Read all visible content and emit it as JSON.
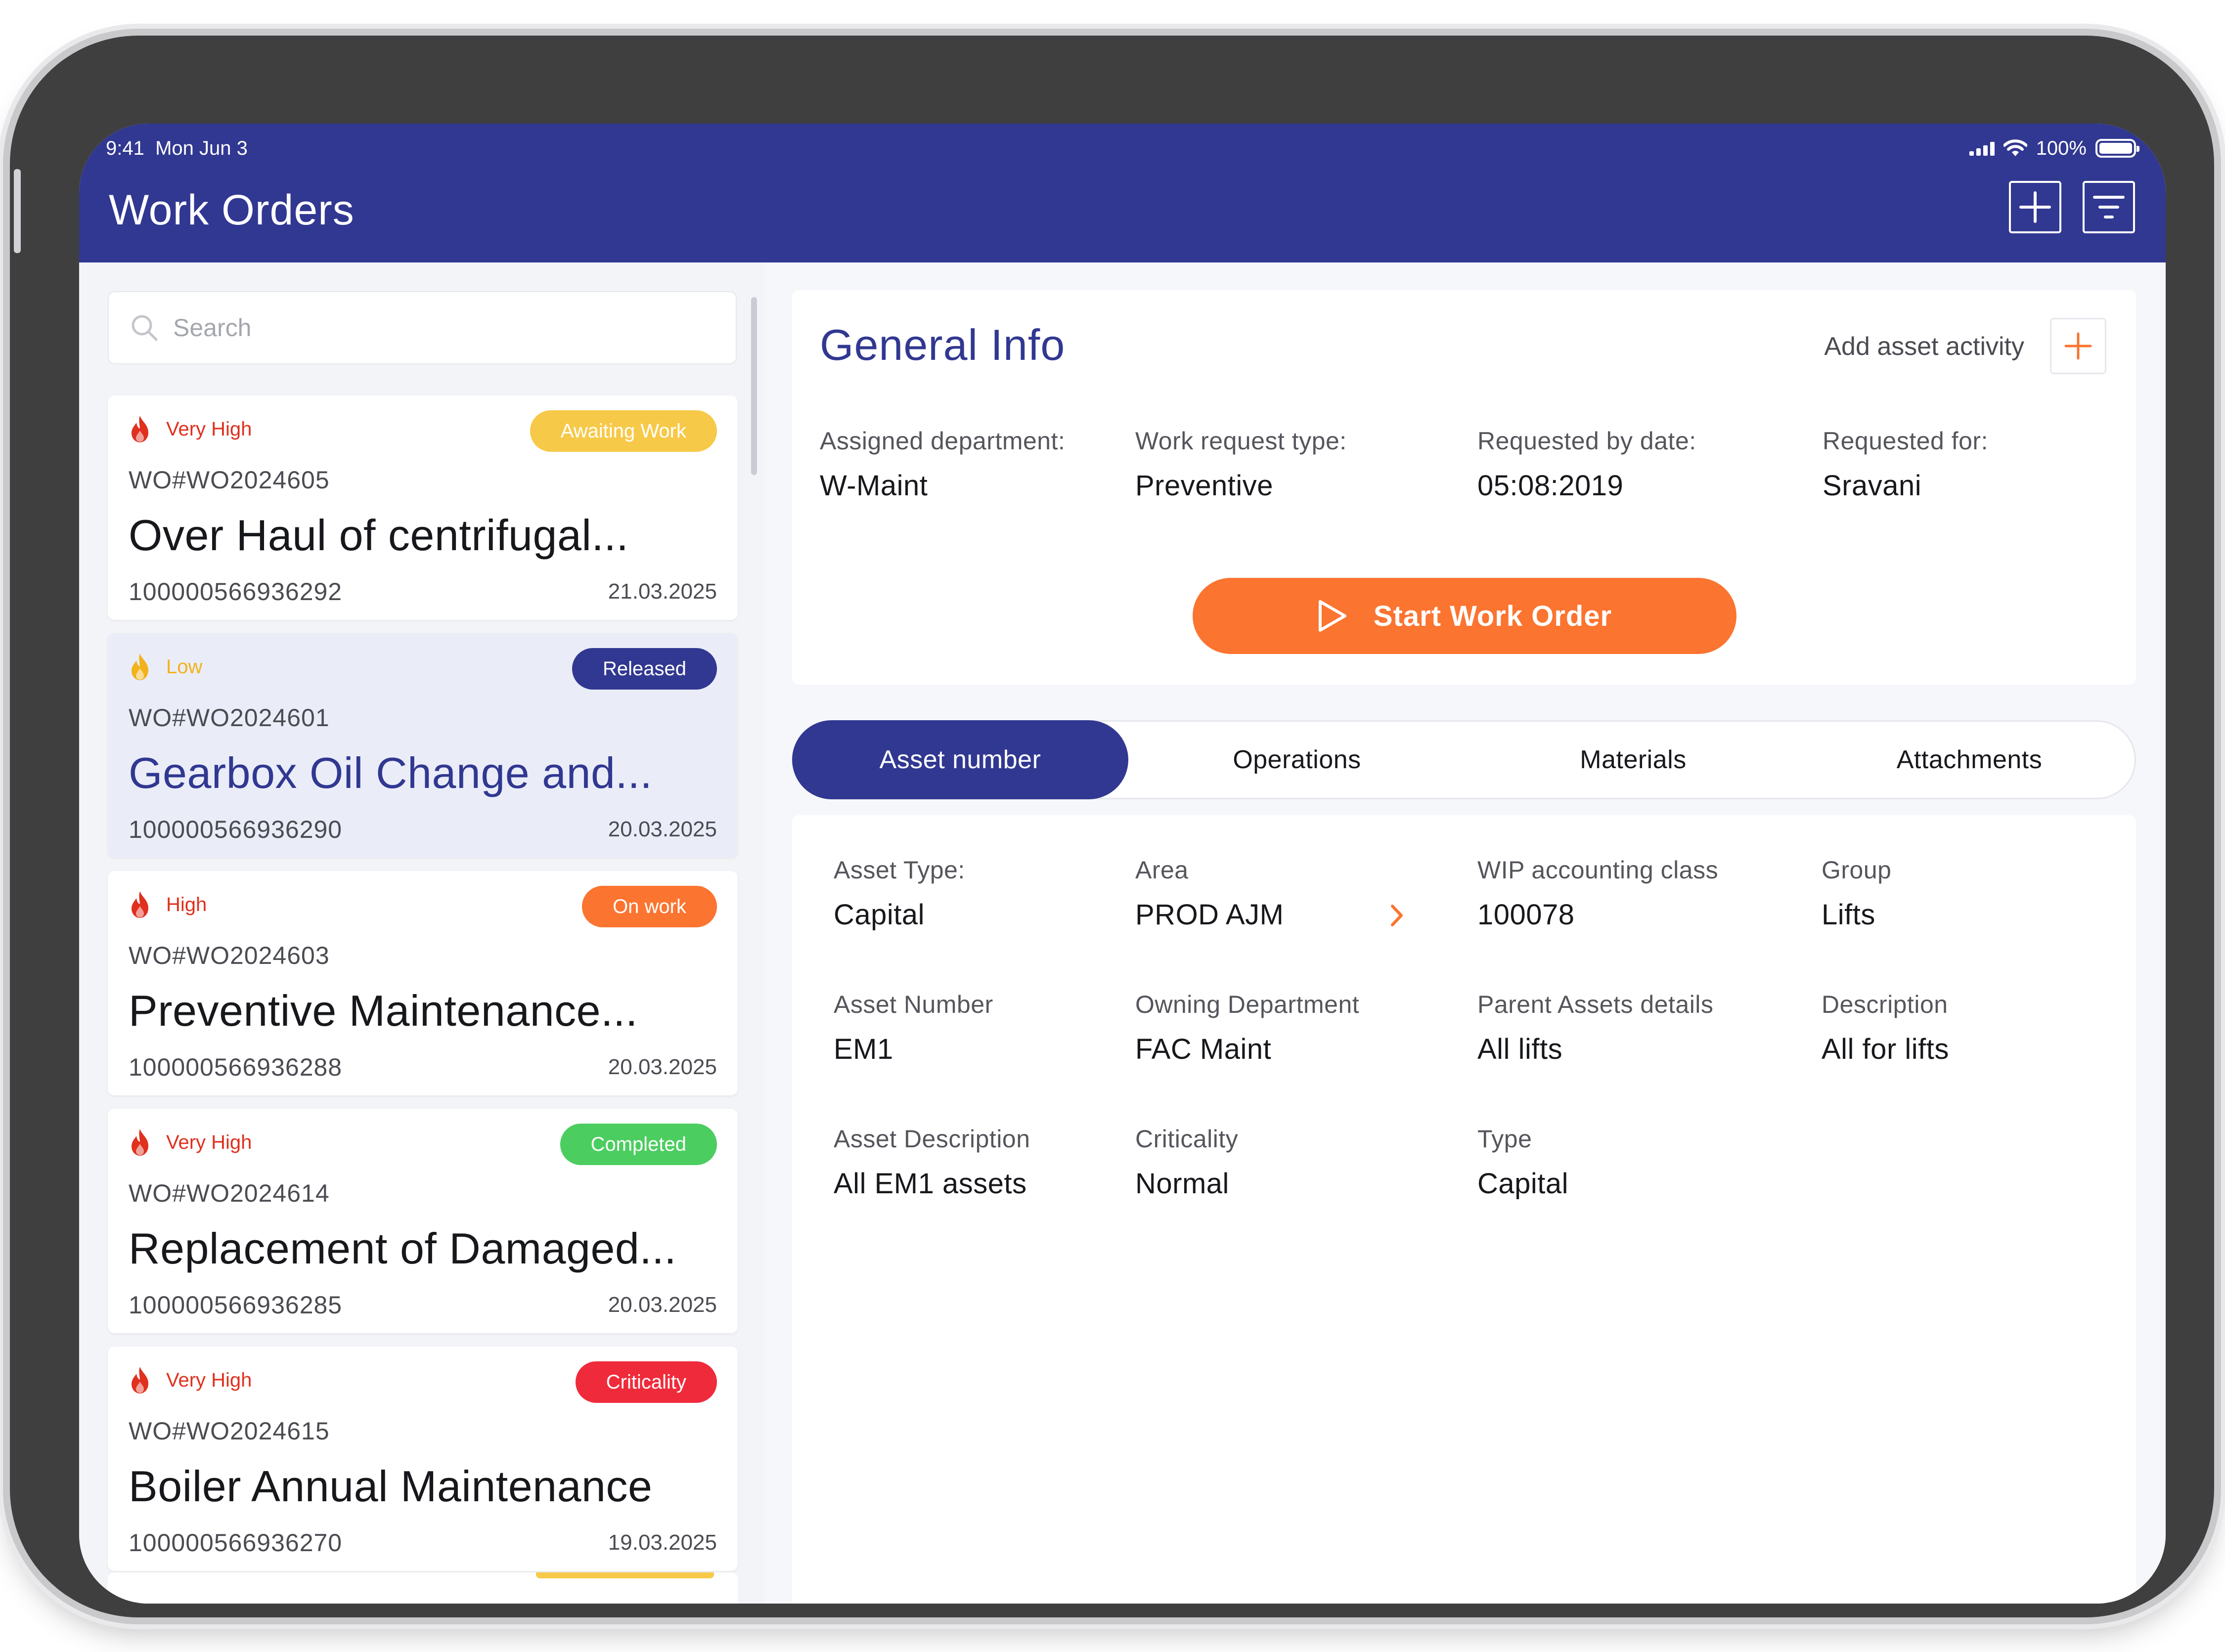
{
  "status_bar": {
    "time": "9:41",
    "date": "Mon Jun 3",
    "battery": "100%"
  },
  "header": {
    "title": "Work Orders"
  },
  "search": {
    "placeholder": "Search"
  },
  "work_orders": [
    {
      "priority": "Very High",
      "priority_color": "#e0301e",
      "status": "Awaiting Work",
      "status_color": "#f7c948",
      "id": "WO#WO2024605",
      "title": "Over Haul of centrifugal...",
      "number": "100000566936292",
      "date": "21.03.2025"
    },
    {
      "priority": "Low",
      "priority_color": "#f2b21b",
      "status": "Released",
      "status_color": "#313891",
      "id": "WO#WO2024601",
      "title": "Gearbox Oil Change and...",
      "number": "100000566936290",
      "date": "20.03.2025"
    },
    {
      "priority": "High",
      "priority_color": "#e0301e",
      "status": "On work",
      "status_color": "#fb7430",
      "id": "WO#WO2024603",
      "title": "Preventive Maintenance...",
      "number": "100000566936288",
      "date": "20.03.2025"
    },
    {
      "priority": "Very High",
      "priority_color": "#e0301e",
      "status": "Completed",
      "status_color": "#4ccd60",
      "id": "WO#WO2024614",
      "title": "Replacement of Damaged...",
      "number": "100000566936285",
      "date": "20.03.2025"
    },
    {
      "priority": "Very High",
      "priority_color": "#e0301e",
      "status": "Criticality",
      "status_color": "#ef2b3b",
      "id": "WO#WO2024615",
      "title": "Boiler Annual Maintenance",
      "number": "100000566936270",
      "date": "19.03.2025"
    }
  ],
  "general_info": {
    "title": "General Info",
    "add_activity_label": "Add asset activity",
    "fields": [
      {
        "label": "Assigned department:",
        "value": "W-Maint"
      },
      {
        "label": "Work request type:",
        "value": "Preventive"
      },
      {
        "label": "Requested by date:",
        "value": "05:08:2019"
      },
      {
        "label": "Requested for:",
        "value": "Sravani"
      }
    ],
    "start_button": "Start Work Order"
  },
  "tabs": [
    "Asset number",
    "Operations",
    "Materials",
    "Attachments"
  ],
  "asset_details": [
    {
      "label": "Asset Type:",
      "value": "Capital"
    },
    {
      "label": "Area",
      "value": "PROD AJM"
    },
    {
      "label": "WIP accounting class",
      "value": "100078"
    },
    {
      "label": "Group",
      "value": "Lifts"
    },
    {
      "label": "Asset Number",
      "value": "EM1"
    },
    {
      "label": "Owning Department",
      "value": "FAC Maint"
    },
    {
      "label": "Parent Assets details",
      "value": "All lifts"
    },
    {
      "label": "Description",
      "value": "All for lifts"
    },
    {
      "label": "Asset Description",
      "value": "All EM1 assets"
    },
    {
      "label": "Criticality",
      "value": "Normal"
    },
    {
      "label": "Type",
      "value": "Capital"
    }
  ],
  "colors": {
    "brand": "#313891",
    "accent": "#fb7430"
  }
}
